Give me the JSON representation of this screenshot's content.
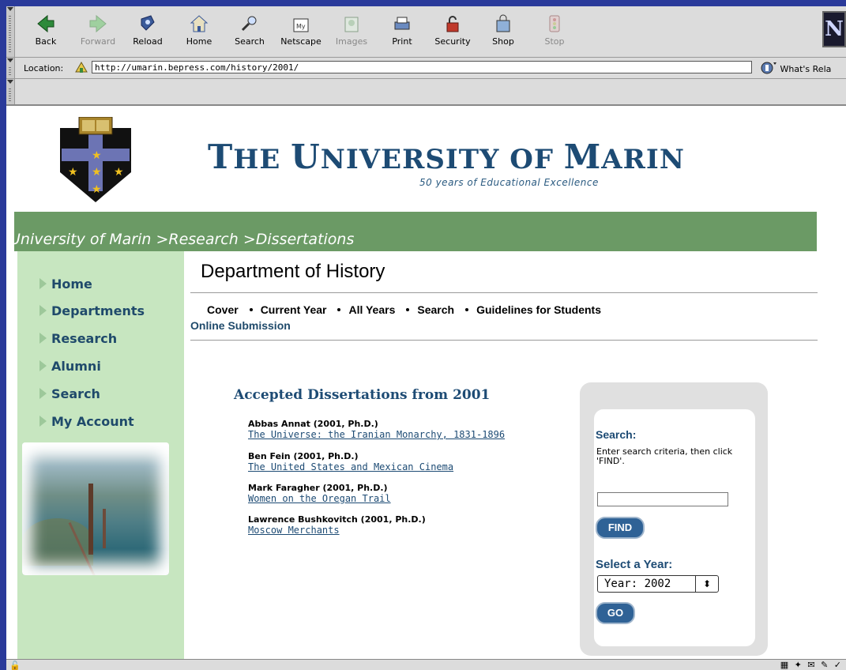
{
  "browser": {
    "toolbar": [
      {
        "label": "Back",
        "icon": "back-arrow-icon",
        "enabled": true
      },
      {
        "label": "Forward",
        "icon": "forward-arrow-icon",
        "enabled": false
      },
      {
        "label": "Reload",
        "icon": "reload-icon",
        "enabled": true
      },
      {
        "label": "Home",
        "icon": "home-icon",
        "enabled": true
      },
      {
        "label": "Search",
        "icon": "search-icon",
        "enabled": true
      },
      {
        "label": "Netscape",
        "icon": "netscape-icon",
        "enabled": true
      },
      {
        "label": "Images",
        "icon": "images-icon",
        "enabled": false
      },
      {
        "label": "Print",
        "icon": "print-icon",
        "enabled": true
      },
      {
        "label": "Security",
        "icon": "lock-icon",
        "enabled": true
      },
      {
        "label": "Shop",
        "icon": "shopping-bag-icon",
        "enabled": true
      },
      {
        "label": "Stop",
        "icon": "stop-icon",
        "enabled": false
      }
    ],
    "logo_letter": "N",
    "location_label": "Location:",
    "url": "http://umarin.bepress.com/history/2001/",
    "whats_related": "What's Rela"
  },
  "site": {
    "title_parts": [
      "T",
      "HE ",
      "U",
      "NIVERSITY OF ",
      "M",
      "ARIN"
    ],
    "tagline": "50 years of Educational Excellence",
    "breadcrumb": [
      "University of Marin",
      ">Research",
      ">Dissertations"
    ]
  },
  "sidebar": {
    "items": [
      "Home",
      "Departments",
      "Research",
      "Alumni",
      "Search",
      "My Account"
    ]
  },
  "main": {
    "dept_title": "Department of History",
    "tabs": [
      "Cover",
      "Current Year",
      "All Years",
      "Search",
      "Guidelines for Students"
    ],
    "online_submission": "Online Submission",
    "accepted_heading": "Accepted Dissertations from 2001",
    "dissertations": [
      {
        "author": "Abbas Annat (2001, Ph.D.)",
        "title": "The Universe: the Iranian Monarchy, 1831-1896"
      },
      {
        "author": "Ben Fein (2001, Ph.D.)",
        "title": "The United States and Mexican Cinema"
      },
      {
        "author": "Mark Faragher (2001, Ph.D.)",
        "title": "Women on the Oregan Trail"
      },
      {
        "author": "Lawrence Bushkovitch (2001, Ph.D.)",
        "title": "Moscow Merchants "
      }
    ]
  },
  "search_box": {
    "label": "Search:",
    "hint": "Enter search criteria, then click 'FIND'.",
    "input_value": "",
    "find_label": "FIND",
    "year_label": "Select a Year:",
    "year_value": "Year: 2002",
    "go_label": "GO"
  },
  "colors": {
    "brand_navy": "#1d4b74",
    "breadcrumb_green": "#6b9a65",
    "sidebar_green": "#c7e6c0",
    "button_blue": "#2f6296"
  }
}
